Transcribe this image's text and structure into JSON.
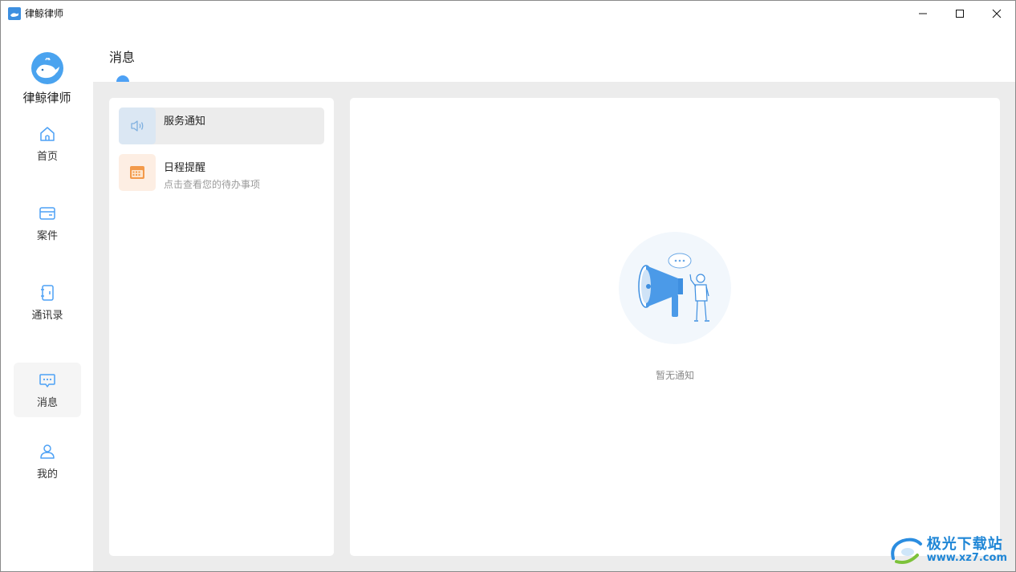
{
  "window": {
    "title": "律鲸律师",
    "controls": [
      "minimize-icon",
      "maximize-icon",
      "close-icon"
    ]
  },
  "sidebar": {
    "brand_name": "律鲸律师",
    "items": [
      {
        "label": "首页",
        "icon": "home-icon",
        "active": false
      },
      {
        "label": "案件",
        "icon": "case-icon",
        "active": false
      },
      {
        "label": "通讯录",
        "icon": "contacts-icon",
        "active": false
      },
      {
        "label": "消息",
        "icon": "message-icon",
        "active": true
      },
      {
        "label": "我的",
        "icon": "user-icon",
        "active": false
      }
    ]
  },
  "main": {
    "title": "消息",
    "messages": [
      {
        "title": "服务通知",
        "subtitle": "",
        "icon": "speaker-icon",
        "selected": true
      },
      {
        "title": "日程提醒",
        "subtitle": "点击查看您的待办事项",
        "icon": "calendar-icon",
        "selected": false
      }
    ],
    "empty_text": "暂无通知"
  },
  "watermark": {
    "name": "极光下载站",
    "url": "www.xz7.com"
  },
  "colors": {
    "accent": "#4da1f5",
    "panel_bg": "#ececec",
    "calendar_orange": "#f39a4a"
  }
}
